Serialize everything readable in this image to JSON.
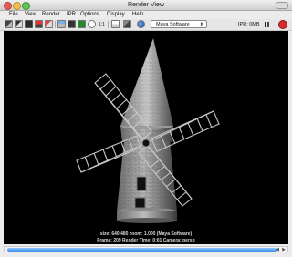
{
  "window": {
    "title": "Render View"
  },
  "menu": {
    "items": [
      "File",
      "View",
      "Render",
      "IPR",
      "Options",
      "Display",
      "Help"
    ]
  },
  "toolbar": {
    "ratio_label": "1:1",
    "renderer": "Maya Software",
    "ipr_status": "IPR: 0MB",
    "icons": [
      "redo-render-icon",
      "render-region-icon",
      "snapshot-icon",
      "ipr-render-icon",
      "refresh-ipr-icon",
      "keep-image-icon",
      "remove-image-icon",
      "display-rgb-icon",
      "display-alpha-icon",
      "real-size-icon",
      "render-settings-icon",
      "hypershade-icon"
    ]
  },
  "viewport": {
    "status_line1": "size: 640  480 zoom: 1.000         (Maya Software)",
    "status_line2": "Frame: 209      Render Time: 0:01      Camera: persp"
  }
}
